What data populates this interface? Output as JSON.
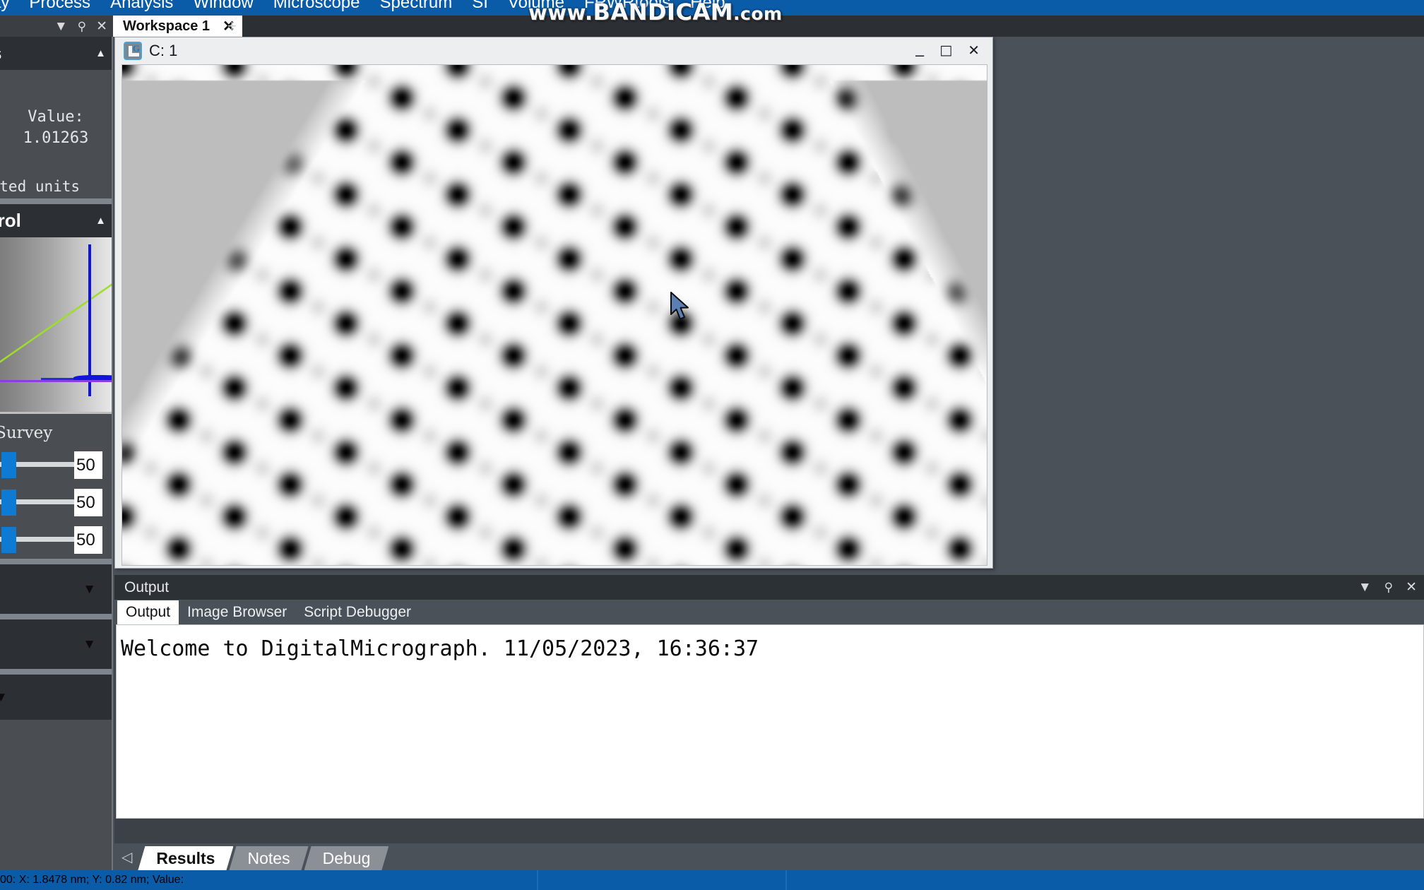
{
  "app": {
    "name": "DigitalMicrograph",
    "accent_blue": "#0a5ba8",
    "panel_dark": "#2c2f33",
    "panel_body": "#4a4d52"
  },
  "menubar": {
    "items": [
      {
        "label": "ay",
        "name": "menu-display"
      },
      {
        "label": "Process",
        "name": "menu-process"
      },
      {
        "label": "Analysis",
        "name": "menu-analysis"
      },
      {
        "label": "Window",
        "name": "menu-window"
      },
      {
        "label": "Microscope",
        "name": "menu-microscope"
      },
      {
        "label": "Spectrum",
        "name": "menu-spectrum"
      },
      {
        "label": "SI",
        "name": "menu-si"
      },
      {
        "label": "Volume",
        "name": "menu-volume"
      },
      {
        "label": "FRWRtools",
        "name": "menu-frwrtools"
      },
      {
        "label": "Help",
        "name": "menu-help"
      }
    ]
  },
  "watermark": {
    "prefix": "www.",
    "brand": "BANDICAM",
    "suffix": ".com"
  },
  "panel_caption": {
    "dropdown_glyph": "▼",
    "pin_glyph": "丬",
    "close_glyph": "✕"
  },
  "workspace": {
    "tab_label": "Workspace 1",
    "close_glyph": "✕",
    "add_glyph": "+"
  },
  "left_dock": {
    "panels": [
      {
        "name": "results-panel",
        "title": "s",
        "caret": "up",
        "value_label": "Value:",
        "value": "1.01263",
        "units_text": "rated units"
      },
      {
        "name": "display-control-panel",
        "title": "trol",
        "caret": "up",
        "survey_label": "toSurvey",
        "sliders": [
          {
            "name": "slider-brightness",
            "value": "50"
          },
          {
            "name": "slider-contrast",
            "value": "50"
          },
          {
            "name": "slider-gamma",
            "value": "50"
          }
        ]
      },
      {
        "name": "collapsed-panel-1",
        "title": "",
        "caret": "down"
      },
      {
        "name": "collapsed-panel-2",
        "title": "",
        "caret": "down"
      },
      {
        "name": "collapsed-panel-3",
        "title": "",
        "caret": "down"
      }
    ]
  },
  "image_window": {
    "title": "C: 1",
    "icon": "digitalmicrograph-icon",
    "minimize_glyph": "–",
    "maximize_glyph": "□",
    "close_glyph": "✕"
  },
  "output_dock": {
    "caption": "Output",
    "tools": {
      "dropdown_glyph": "▼",
      "pin_glyph": "丬",
      "close_glyph": "✕"
    },
    "tabs": [
      {
        "label": "Output",
        "active": true,
        "name": "tab-output"
      },
      {
        "label": "Image Browser",
        "active": false,
        "name": "tab-image-browser"
      },
      {
        "label": "Script Debugger",
        "active": false,
        "name": "tab-script-debugger"
      }
    ],
    "message": "Welcome to DigitalMicrograph.  11/05/2023, 16:36:37",
    "bottom_nav_glyph": "◁",
    "bottom_tabs": [
      {
        "label": "Results",
        "active": true,
        "name": "tab-results"
      },
      {
        "label": "Notes",
        "active": false,
        "name": "tab-notes"
      },
      {
        "label": "Debug",
        "active": false,
        "name": "tab-debug"
      }
    ]
  },
  "status_bar": {
    "text": "00:  X:  1.8478 nm;  Y:  0.82 nm;  Value:"
  },
  "lattice": {
    "description": "simulated HRTEM hexagonal atomic lattice",
    "background_gray": "#bdbdbd",
    "spot_dark": "#0a0a0a",
    "field_light": "#f7f7f7",
    "lattice_a": 79,
    "tilt_deg": 0
  }
}
